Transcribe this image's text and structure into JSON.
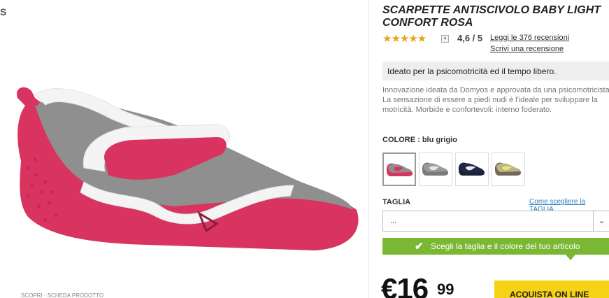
{
  "left_edge": {
    "glyph": "S",
    "bottom_text": "SCOPRI · SCHEDA PRODOTTO"
  },
  "product": {
    "title": "SCARPETTE ANTISCIVOLO BABY LIGHT CONFORT ROSA",
    "rating": {
      "stars": "★★★★★",
      "value": 4.6,
      "score_text": "4,6 / 5",
      "dropdown_glyph": "▾"
    },
    "reviews_link": "Leggi le 376 recensioni",
    "write_review_link": "Scrivi una recensione",
    "highlight": "Ideato per la psicomotricità ed il tempo libero.",
    "description": "Innovazione ideata da Domyos e approvata da una psicomotricista. La sensazione di essere a piedi nudi è l'ideale per sviluppare la motricità. Morbide e confortevoli: interno foderato."
  },
  "color": {
    "label": "COLORE : blu grigio",
    "swatches": [
      {
        "name": "grigio rosa",
        "body": "#8f8f8f",
        "accent": "#d9335f",
        "sole": "#d9335f",
        "selected": true
      },
      {
        "name": "grigio",
        "body": "#9a9a9a",
        "accent": "#e6e6e6",
        "sole": "#7a7a7a",
        "selected": false
      },
      {
        "name": "blu",
        "body": "#1f2a48",
        "accent": "#eeeeee",
        "sole": "#1a2238",
        "selected": false
      },
      {
        "name": "giallo",
        "body": "#b9b48a",
        "accent": "#f1e36a",
        "sole": "#6f6a55",
        "selected": false
      }
    ]
  },
  "size": {
    "label": "TAGLIA",
    "help_link": "Come scegliere la TAGLIA",
    "selected": "...",
    "arrow": "⌄"
  },
  "banner": {
    "check": "✔",
    "text": "Scegli la taglia e il colore del tuo articolo"
  },
  "price": {
    "main": "€16",
    "cents": "99"
  },
  "buy_label": "ACQUISTA ON LINE",
  "colors": {
    "banner_green": "#7ab833",
    "buy_yellow": "#f5d216",
    "star_orange": "#e8a317",
    "link_blue": "#2a7fc1",
    "shoe_pink": "#d9335f",
    "shoe_grey": "#8f8f8f"
  }
}
